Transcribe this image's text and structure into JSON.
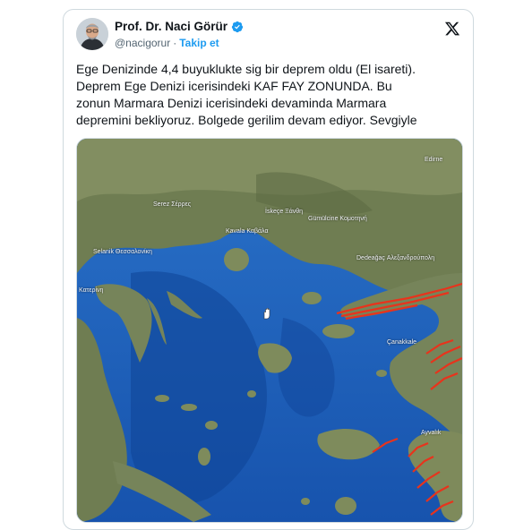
{
  "tweet": {
    "author_name": "Prof. Dr. Naci Görür",
    "handle": "@nacigorur",
    "separator": "·",
    "follow_label": "Takip et",
    "text": "Ege Denizinde 4,4 buyuklukte sig bir deprem oldu (El isareti).\nDeprem Ege Denizi icerisindeki KAF FAY ZONUNDA.  Bu\nzonun Marmara Denizi icerisindeki devaminda Marmara\ndepremini bekliyoruz. Bolgede gerilim devam ediyor. Sevgiyle"
  },
  "map": {
    "labels": {
      "edirne": "Edirne",
      "serez": "Serez Σέρρες",
      "iskece": "İskeçe Ξάνθη",
      "gumulcine": "Gümülcine Κομοτηνή",
      "kavala": "Kavala Καβάλα",
      "selanik": "Selanik Θεσσαλονίκη",
      "dedeagac": "Dedeağaç Αλεξανδρούπολη",
      "katerini": "Κατερίνη",
      "canakkale": "Çanakkale",
      "ayvalik": "Ayvalık"
    },
    "colors": {
      "sea": "#1f63bd",
      "deep_sea": "#0d3f8f",
      "land": "#7d8a5f",
      "fault": "#e8331c"
    },
    "marker_icon": "hand-icon"
  }
}
